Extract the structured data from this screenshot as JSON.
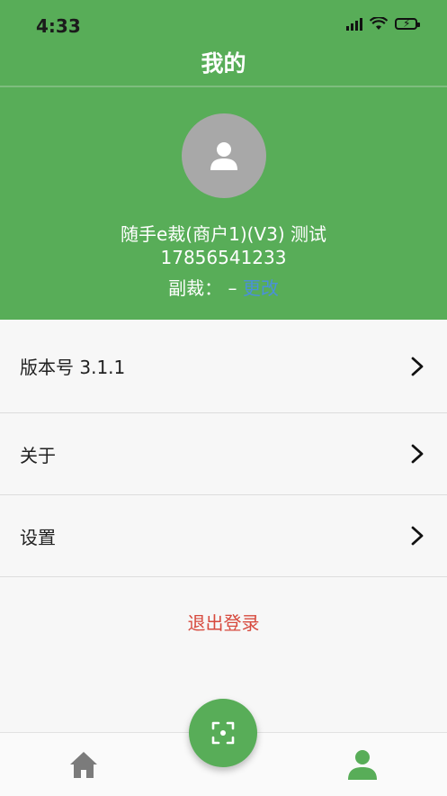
{
  "status_bar": {
    "time": "4:33",
    "icons": [
      "signal-icon",
      "wifi-icon",
      "battery-charging-icon"
    ]
  },
  "header": {
    "title": "我的"
  },
  "profile": {
    "name": "随手e裁(商户1)(V3) 测试",
    "phone": "17856541233",
    "sub_cutter_label": "副裁：",
    "sub_cutter_value": " – ",
    "change_link": "更改"
  },
  "menu": {
    "items": [
      {
        "label": "版本号 3.1.1",
        "icon": "chevron-right-icon"
      },
      {
        "label": "关于",
        "icon": "chevron-right-icon"
      },
      {
        "label": "设置",
        "icon": "chevron-right-icon"
      }
    ]
  },
  "logout": {
    "label": "退出登录"
  },
  "tabbar": {
    "items": [
      {
        "icon": "home-icon",
        "state": "inactive"
      },
      {
        "icon": "scan-icon",
        "state": "floating"
      },
      {
        "icon": "user-icon",
        "state": "active"
      }
    ]
  },
  "colors": {
    "primary_green": "#58ad58",
    "link_blue": "#4a90d9",
    "logout_red": "#d74a3e",
    "avatar_gray": "#a8a8a8"
  }
}
